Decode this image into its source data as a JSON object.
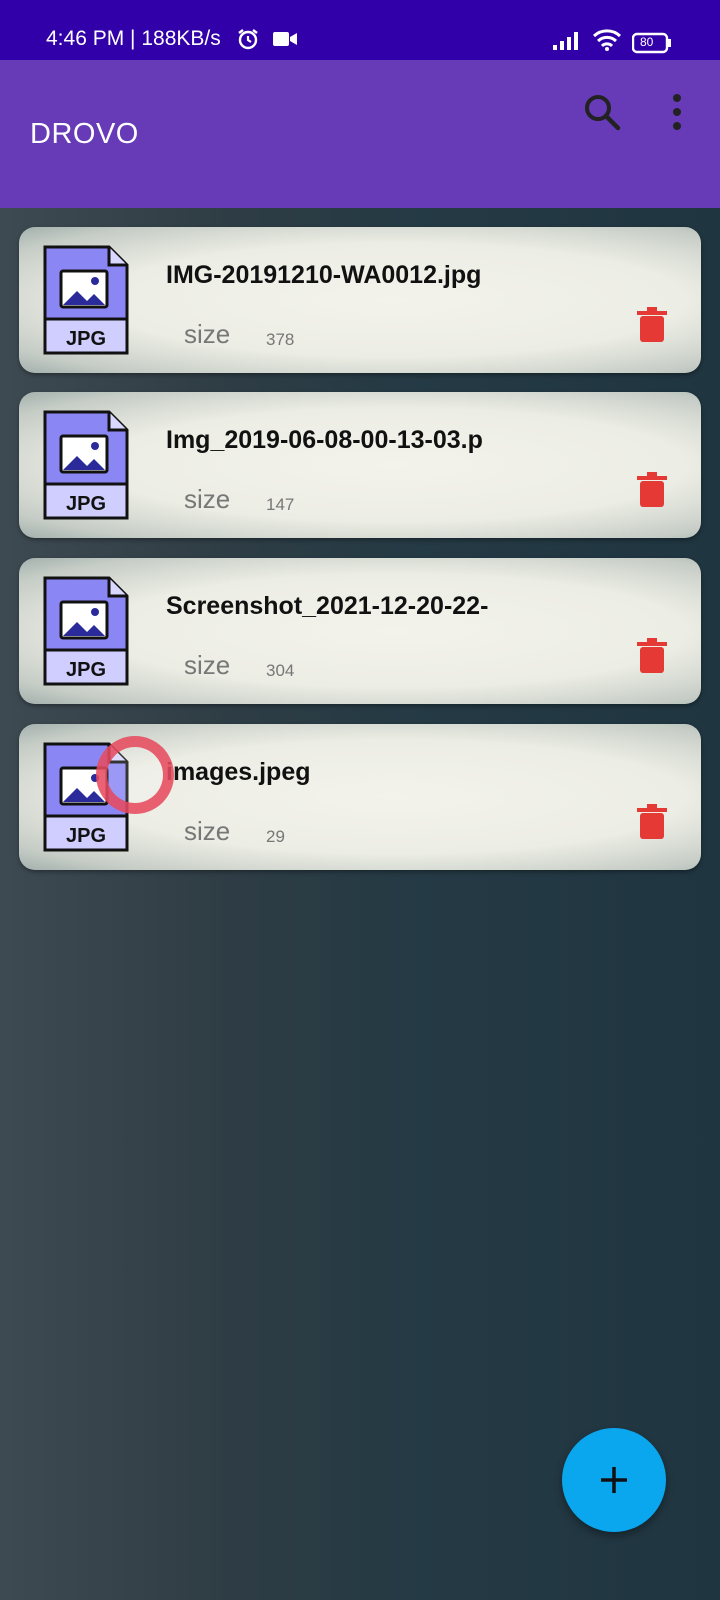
{
  "status_bar": {
    "time": "4:46 PM | 188KB/s",
    "battery": "80",
    "icons": [
      "alarm-icon",
      "video-icon",
      "signal-icon",
      "wifi-icon",
      "battery-icon"
    ]
  },
  "app_bar": {
    "title": "DROVO",
    "actions": [
      "search-icon",
      "more-vert-icon"
    ]
  },
  "files": [
    {
      "name": "IMG-20191210-WA0012.jpg",
      "size_label": "size",
      "size_value": "378",
      "badge": "JPG"
    },
    {
      "name": "Img_2019-06-08-00-13-03.p",
      "size_label": "size",
      "size_value": "147",
      "badge": "JPG"
    },
    {
      "name": "Screenshot_2021-12-20-22-",
      "size_label": "size",
      "size_value": "304",
      "badge": "JPG"
    },
    {
      "name": "images.jpeg",
      "size_label": "size",
      "size_value": "29",
      "badge": "JPG"
    }
  ],
  "fab": {
    "icon": "plus-icon"
  },
  "colors": {
    "status_bar": "#3200a8",
    "app_bar": "#673ab7",
    "fab": "#0aa6ee",
    "delete": "#e53935",
    "file_icon": "#8a87f5"
  }
}
